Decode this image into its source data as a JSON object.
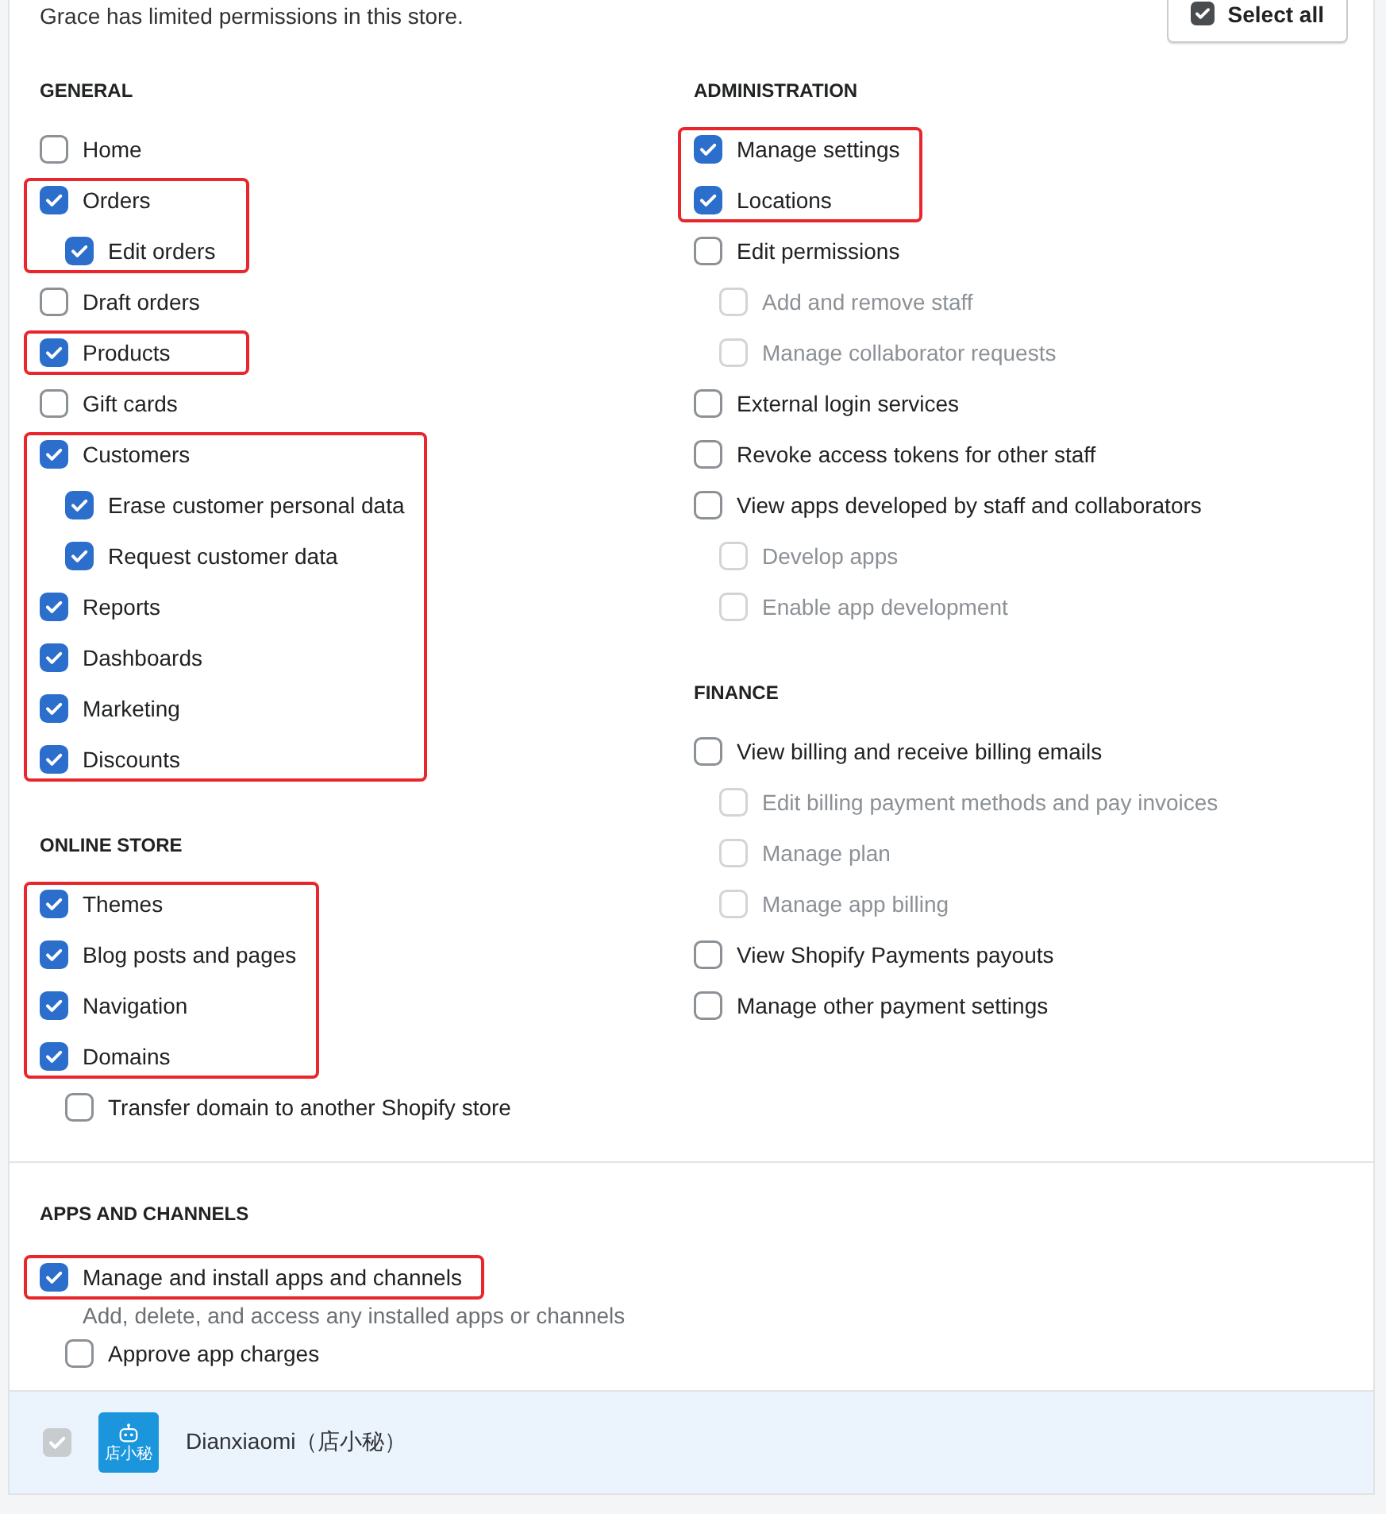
{
  "notice": "Grace has limited permissions in this store.",
  "select_all": {
    "label": "Select all",
    "checked": true
  },
  "columns": [
    {
      "sections": [
        {
          "heading": "GENERAL",
          "items": [
            {
              "label": "Home",
              "checked": false,
              "disabled": false,
              "highlighted": false
            },
            {
              "label": "Orders",
              "checked": true,
              "disabled": false,
              "highlighted": true,
              "children": [
                {
                  "label": "Edit orders",
                  "checked": true,
                  "disabled": false,
                  "highlighted": true
                }
              ]
            },
            {
              "label": "Draft orders",
              "checked": false,
              "disabled": false,
              "highlighted": false
            },
            {
              "label": "Products",
              "checked": true,
              "disabled": false,
              "highlighted": true
            },
            {
              "label": "Gift cards",
              "checked": false,
              "disabled": false,
              "highlighted": false
            },
            {
              "label": "Customers",
              "checked": true,
              "disabled": false,
              "highlighted": true,
              "children": [
                {
                  "label": "Erase customer personal data",
                  "checked": true,
                  "disabled": false,
                  "highlighted": true
                },
                {
                  "label": "Request customer data",
                  "checked": true,
                  "disabled": false,
                  "highlighted": true
                }
              ]
            },
            {
              "label": "Reports",
              "checked": true,
              "disabled": false,
              "highlighted": true
            },
            {
              "label": "Dashboards",
              "checked": true,
              "disabled": false,
              "highlighted": true
            },
            {
              "label": "Marketing",
              "checked": true,
              "disabled": false,
              "highlighted": true
            },
            {
              "label": "Discounts",
              "checked": true,
              "disabled": false,
              "highlighted": true
            }
          ]
        },
        {
          "heading": "ONLINE STORE",
          "items": [
            {
              "label": "Themes",
              "checked": true,
              "disabled": false,
              "highlighted": true
            },
            {
              "label": "Blog posts and pages",
              "checked": true,
              "disabled": false,
              "highlighted": true
            },
            {
              "label": "Navigation",
              "checked": true,
              "disabled": false,
              "highlighted": true
            },
            {
              "label": "Domains",
              "checked": true,
              "disabled": false,
              "highlighted": true,
              "children": [
                {
                  "label": "Transfer domain to another Shopify store",
                  "checked": false,
                  "disabled": false,
                  "highlighted": false
                }
              ]
            }
          ]
        }
      ]
    },
    {
      "sections": [
        {
          "heading": "ADMINISTRATION",
          "items": [
            {
              "label": "Manage settings",
              "checked": true,
              "disabled": false,
              "highlighted": true
            },
            {
              "label": "Locations",
              "checked": true,
              "disabled": false,
              "highlighted": true
            },
            {
              "label": "Edit permissions",
              "checked": false,
              "disabled": false,
              "highlighted": false,
              "children": [
                {
                  "label": "Add and remove staff",
                  "checked": false,
                  "disabled": true,
                  "highlighted": false
                },
                {
                  "label": "Manage collaborator requests",
                  "checked": false,
                  "disabled": true,
                  "highlighted": false
                }
              ]
            },
            {
              "label": "External login services",
              "checked": false,
              "disabled": false,
              "highlighted": false
            },
            {
              "label": "Revoke access tokens for other staff",
              "checked": false,
              "disabled": false,
              "highlighted": false
            },
            {
              "label": "View apps developed by staff and collaborators",
              "checked": false,
              "disabled": false,
              "highlighted": false,
              "children": [
                {
                  "label": "Develop apps",
                  "checked": false,
                  "disabled": true,
                  "highlighted": false
                },
                {
                  "label": "Enable app development",
                  "checked": false,
                  "disabled": true,
                  "highlighted": false
                }
              ]
            }
          ]
        },
        {
          "heading": "FINANCE",
          "items": [
            {
              "label": "View billing and receive billing emails",
              "checked": false,
              "disabled": false,
              "highlighted": false,
              "children": [
                {
                  "label": "Edit billing payment methods and pay invoices",
                  "checked": false,
                  "disabled": true,
                  "highlighted": false
                },
                {
                  "label": "Manage plan",
                  "checked": false,
                  "disabled": true,
                  "highlighted": false
                },
                {
                  "label": "Manage app billing",
                  "checked": false,
                  "disabled": true,
                  "highlighted": false
                }
              ]
            },
            {
              "label": "View Shopify Payments payouts",
              "checked": false,
              "disabled": false,
              "highlighted": false
            },
            {
              "label": "Manage other payment settings",
              "checked": false,
              "disabled": false,
              "highlighted": false
            }
          ]
        }
      ]
    }
  ],
  "apps_section": {
    "heading": "APPS AND CHANNELS",
    "items": [
      {
        "label": "Manage and install apps and channels",
        "checked": true,
        "disabled": false,
        "highlighted": true,
        "description": "Add, delete, and access any installed apps or channels",
        "children": [
          {
            "label": "Approve app charges",
            "checked": false,
            "disabled": false,
            "highlighted": false
          }
        ]
      }
    ]
  },
  "installed_apps": [
    {
      "name": "Dianxiaomi（店小秘）",
      "logo_text": "店小秘",
      "checked": true,
      "disabled": true
    }
  ]
}
